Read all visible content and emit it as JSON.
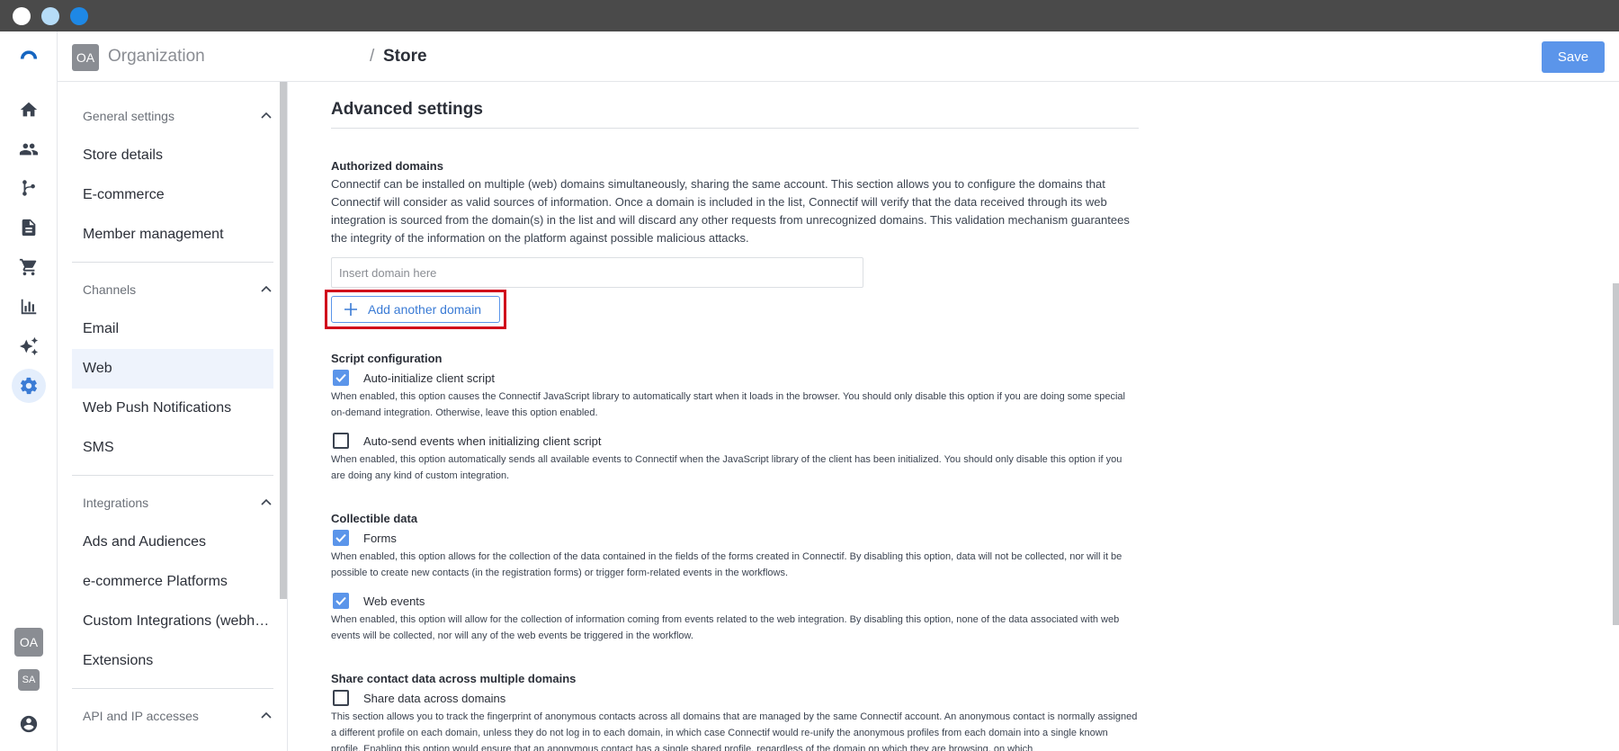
{
  "window": {
    "dots": [
      "#ffffff",
      "#b6dcf7",
      "#1e88e5"
    ]
  },
  "topbar": {
    "org_initials": "OA",
    "org_name": "Organization",
    "separator": "/",
    "page": "Store",
    "save_label": "Save"
  },
  "rail": {
    "icons": [
      "logo-icon",
      "home-icon",
      "people-icon",
      "workflow-icon",
      "document-icon",
      "cart-icon",
      "analytics-icon",
      "sparkle-icon",
      "settings-icon",
      "user-circle-icon"
    ],
    "avatars": [
      "OA",
      "SA"
    ],
    "active": "settings-icon"
  },
  "sidebar": {
    "sections": [
      {
        "title": "General settings",
        "items": [
          "Store details",
          "E-commerce",
          "Member management"
        ]
      },
      {
        "title": "Channels",
        "items": [
          "Email",
          "Web",
          "Web Push Notifications",
          "SMS"
        ]
      },
      {
        "title": "Integrations",
        "items": [
          "Ads and Audiences",
          "e-commerce Platforms",
          "Custom Integrations (webhooks)",
          "Extensions"
        ]
      },
      {
        "title": "API and IP accesses",
        "items": []
      }
    ],
    "selected": "Web"
  },
  "main": {
    "heading": "Advanced settings",
    "authorized": {
      "label": "Authorized domains",
      "description": "Connectif can be installed on multiple (web) domains simultaneously, sharing the same account. This section allows you to configure the domains that Connectif will consider as valid sources of information. Once a domain is included in the list, Connectif will verify that the data received through its web integration is sourced from the domain(s) in the list and will discard any other requests from unrecognized domains. This validation mechanism guarantees the integrity of the information on the platform against possible malicious attacks.",
      "input_placeholder": "Insert domain here",
      "input_value": "",
      "add_label": "Add another domain"
    },
    "script": {
      "label": "Script configuration",
      "options": [
        {
          "label": "Auto-initialize client script",
          "checked": true,
          "help": "When enabled, this option causes the Connectif JavaScript library to automatically start when it loads in the browser. You should only disable this option if you are doing some special on-demand integration. Otherwise, leave this option enabled."
        },
        {
          "label": "Auto-send events when initializing client script",
          "checked": false,
          "help": "When enabled, this option automatically sends all available events to Connectif when the JavaScript library of the client has been initialized. You should only disable this option if you are doing any kind of custom integration."
        }
      ]
    },
    "collectible": {
      "label": "Collectible data",
      "options": [
        {
          "label": "Forms",
          "checked": true,
          "help": "When enabled, this option allows for the collection of the data contained in the fields of the forms created in Connectif. By disabling this option, data will not be collected, nor will it be possible to create new contacts (in the registration forms) or trigger form-related events in the workflows."
        },
        {
          "label": "Web events",
          "checked": true,
          "help": "When enabled, this option will allow for the collection of information coming from events related to the web integration. By disabling this option, none of the data associated with web events will be collected, nor will any of the web events be triggered in the workflow."
        }
      ]
    },
    "share": {
      "label": "Share contact data across multiple domains",
      "option_label": "Share data across domains",
      "checked": false,
      "help": "This section allows you to track the fingerprint of anonymous contacts across all domains that are managed by the same Connectif account. An anonymous contact is normally assigned a different profile on each domain, unless they do not log in to each domain, in which case Connectif would re-unify the anonymous profiles from each domain into a single known profile. Enabling this option would ensure that an anonymous contact has a single shared profile, regardless of the domain on which they are browsing, on which"
    }
  },
  "colors": {
    "accent": "#5b95ea",
    "highlight": "#d0021b",
    "selected_bg": "#eef3fc"
  }
}
